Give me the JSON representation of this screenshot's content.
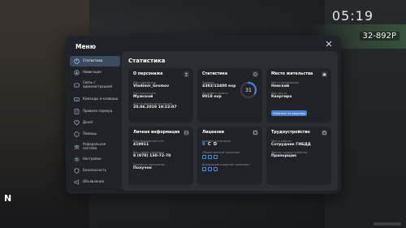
{
  "hud": {
    "time": "05:19",
    "plate": "32-892P",
    "compass": "N"
  },
  "modal": {
    "title": "Меню",
    "close_icon": "close-icon"
  },
  "sidebar": {
    "items": [
      {
        "label": "Статистика",
        "icon": "stats-icon",
        "active": true
      },
      {
        "label": "Навигация",
        "icon": "navigation-icon",
        "active": false
      },
      {
        "label": "Связь с администрацией",
        "icon": "chat-icon",
        "active": false
      },
      {
        "label": "Команды и клавиши",
        "icon": "keyboard-icon",
        "active": false
      },
      {
        "label": "Правила сервера",
        "icon": "rules-icon",
        "active": false
      },
      {
        "label": "Донат",
        "icon": "donate-icon",
        "active": false
      },
      {
        "label": "Помощь",
        "icon": "help-icon",
        "active": false
      },
      {
        "label": "Реферальная система",
        "icon": "referral-icon",
        "active": false
      },
      {
        "label": "Настройки",
        "icon": "settings-icon",
        "active": false
      },
      {
        "label": "Безопасность",
        "icon": "security-icon",
        "active": false
      },
      {
        "label": "Объявления",
        "icon": "announcement-icon",
        "active": false
      }
    ]
  },
  "content": {
    "title": "Статистика",
    "about": {
      "title": "О персонаже",
      "name_label": "Имя и фамилия",
      "name_value": "Vladimir_Gromov",
      "gender_label": "Пол персонажа",
      "gender_value": "Мужской",
      "reg_label": "Дата и время регистрации",
      "reg_value": "20.06.2019 19:22:07"
    },
    "stats": {
      "title": "Статистика",
      "exp_label": "Уровень",
      "exp_value": "4382/13400 exp",
      "next_label": "До нового уровня",
      "next_value": "9018 exp",
      "level": "31",
      "level_progress": 0.33
    },
    "residence": {
      "title": "Место жительства",
      "place_label": "Место проживания",
      "place_value": "Невский",
      "address_label": "Ваш место",
      "address_value": "Квартира",
      "button_label": "Оплатить за квартиру"
    },
    "personal": {
      "title": "Личная информация",
      "bank_label": "Ваш банковский счёт",
      "bank_value": "419911",
      "phone_label": "Ваш номер телефона",
      "phone_value": "8 (978) 130-72-70",
      "marriage_label": "Семейное положение",
      "marriage_value": "Получен"
    },
    "licenses": {
      "title": "Лицензии",
      "categories_label": "Базовые категории",
      "categories": [
        "B",
        "C",
        "D"
      ],
      "public_label": "Общественный транспорт",
      "air_label": "Воздушный и водный транспорт"
    },
    "employment": {
      "title": "Трудоустройство",
      "job_label": "Место работы",
      "job_value": "Сотрудник ГИБДД",
      "rank_label": "Звание трудоустройства",
      "rank_value": "Прапорщик"
    }
  },
  "colors": {
    "accent": "#4a7fd0",
    "active_nav": "#3b4a5c",
    "modal_bg": "#1f2226",
    "panel_bg": "#2a2e33"
  }
}
